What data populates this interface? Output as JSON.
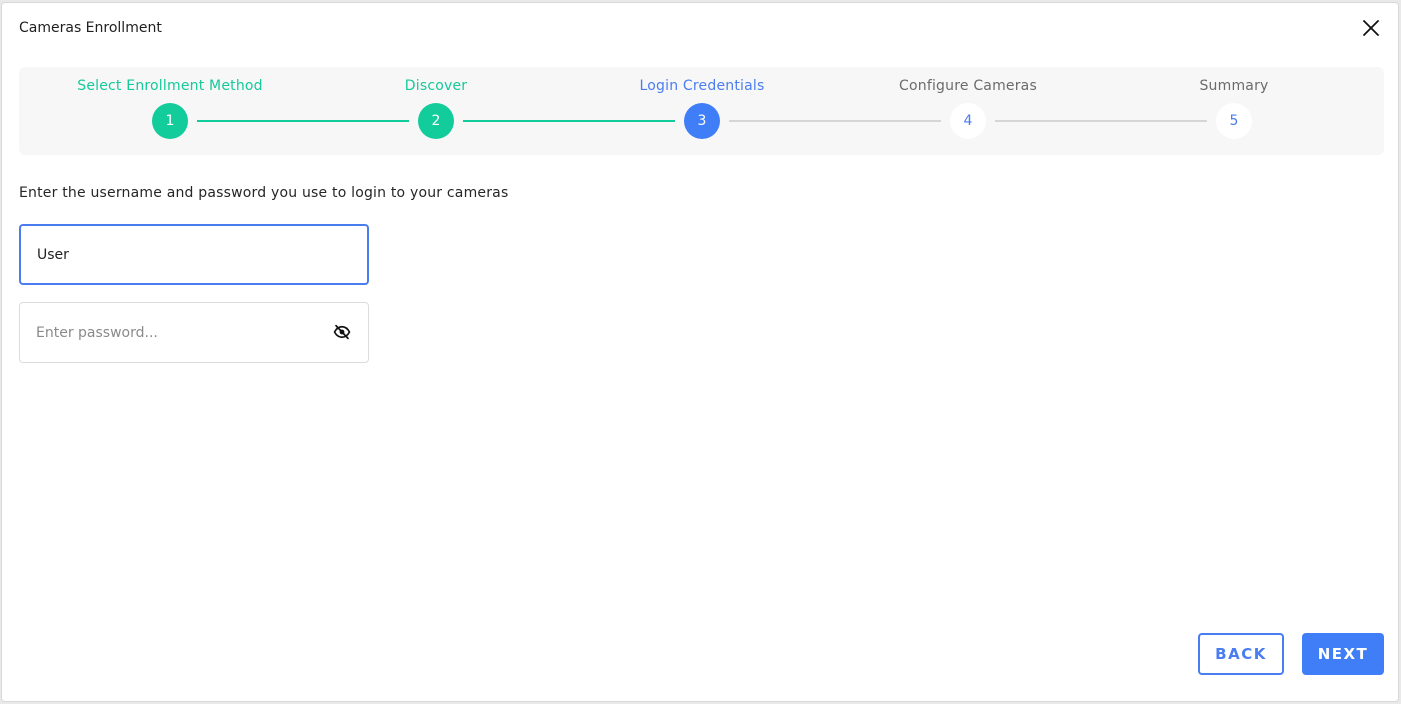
{
  "dialog": {
    "title": "Cameras Enrollment",
    "close_icon": "close-icon"
  },
  "stepper": {
    "steps": [
      {
        "label": "Select Enrollment Method",
        "number": "1",
        "state": "done"
      },
      {
        "label": "Discover",
        "number": "2",
        "state": "done"
      },
      {
        "label": "Login Credentials",
        "number": "3",
        "state": "active"
      },
      {
        "label": "Configure Cameras",
        "number": "4",
        "state": "todo"
      },
      {
        "label": "Summary",
        "number": "5",
        "state": "todo"
      }
    ],
    "colors": {
      "done": "#13cc9b",
      "active": "#3f7ef7",
      "todo_line": "#d6d6d6"
    }
  },
  "form": {
    "instruction": "Enter the username and password you use to login to your cameras",
    "username": {
      "value": "User",
      "placeholder": ""
    },
    "password": {
      "value": "",
      "placeholder": "Enter password...",
      "toggle_icon": "eye-off-icon"
    }
  },
  "actions": {
    "back_label": "BACK",
    "next_label": "NEXT",
    "accent": "#3f7ef7"
  }
}
